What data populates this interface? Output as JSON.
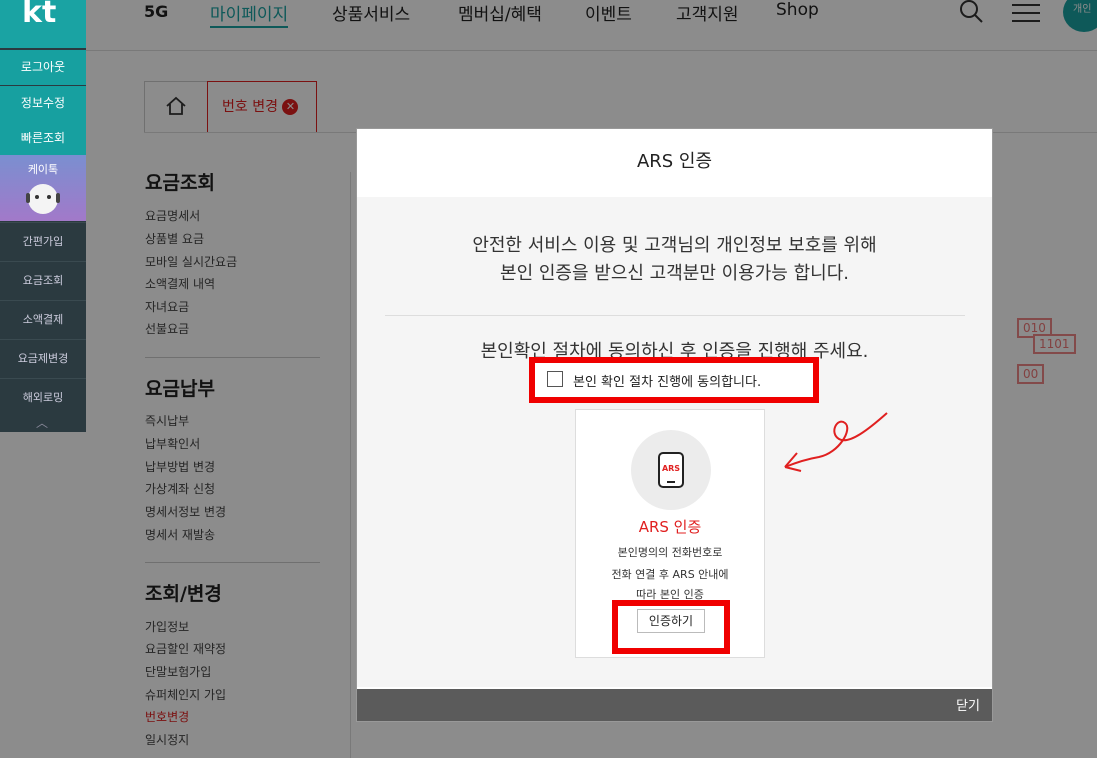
{
  "quickbar": {
    "logo": "kt",
    "items_top": [
      "로그아웃",
      "정보수정",
      "빠른조회"
    ],
    "kaytalk": "케이톡",
    "items_bottom": [
      "간편가입",
      "요금조회",
      "소액결제",
      "요금제변경",
      "해외로밍"
    ]
  },
  "header": {
    "badge": "5G",
    "nav": [
      "마이페이지",
      "상품서비스",
      "멤버십/혜택",
      "이벤트",
      "고객지원",
      "Shop"
    ],
    "avatar": "개인"
  },
  "tabs": {
    "active": "번호 변경"
  },
  "sidemenu": {
    "sections": [
      {
        "title": "요금조회",
        "items": [
          "요금명세서",
          "상품별 요금",
          "모바일 실시간요금",
          "소액결제 내역",
          "자녀요금",
          "선불요금"
        ]
      },
      {
        "title": "요금납부",
        "items": [
          "즉시납부",
          "납부확인서",
          "납부방법 변경",
          "가상계좌 신청",
          "명세서정보 변경",
          "명세서 재발송"
        ]
      },
      {
        "title": "조회/변경",
        "items": [
          "가입정보",
          "요금할인 재약정",
          "단말보험가입",
          "슈퍼체인지 가입",
          "번호변경",
          "일시정지"
        ]
      }
    ],
    "active_item": "번호변경"
  },
  "background": {
    "binary": [
      "010",
      "1101",
      "00"
    ]
  },
  "modal": {
    "title": "ARS 인증",
    "notice_line1": "안전한 서비스 이용 및 고객님의 개인정보 보호를 위해",
    "notice_line2": "본인 인증을 받으신 고객분만 이용가능 합니다.",
    "instruction": "본인확인 절차에 동의하신 후 인증을 진행해 주세요.",
    "agree_label": "본인 확인 절차 진행에 동의합니다.",
    "card": {
      "icon_text": "ARS",
      "title": "ARS 인증",
      "desc1": "본인명의의 전화번호로",
      "desc2": "전화 연결 후 ARS 안내에",
      "desc3": "따라 본인 인증",
      "button": "인증하기"
    },
    "close": "닫기"
  },
  "colors": {
    "brand": "#1aa3a3",
    "accent": "#e02020",
    "highlight": "#f00000"
  }
}
